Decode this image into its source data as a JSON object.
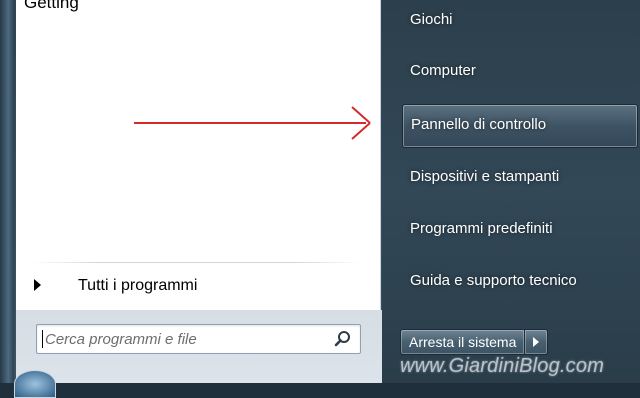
{
  "left": {
    "top_fragment": "Getting",
    "all_programs_label": "Tutti i programmi",
    "search": {
      "placeholder": "Cerca programmi e file",
      "value": ""
    }
  },
  "right": {
    "items": [
      {
        "label": "Giochi"
      },
      {
        "label": "Computer"
      },
      {
        "label": "Pannello di controllo"
      },
      {
        "label": "Dispositivi e stampanti"
      },
      {
        "label": "Programmi predefiniti"
      },
      {
        "label": "Guida e supporto tecnico"
      }
    ],
    "shutdown_label": "Arresta il sistema"
  },
  "watermark": "www.GiardiniBlog.com",
  "colors": {
    "arrow": "#d42a2a",
    "highlight": "#4b6070"
  },
  "icons": {
    "search": "search-icon",
    "shutdown_menu": "chevron-right-icon",
    "all_programs": "triangle-right-icon",
    "annotation": "red-arrow-icon"
  }
}
